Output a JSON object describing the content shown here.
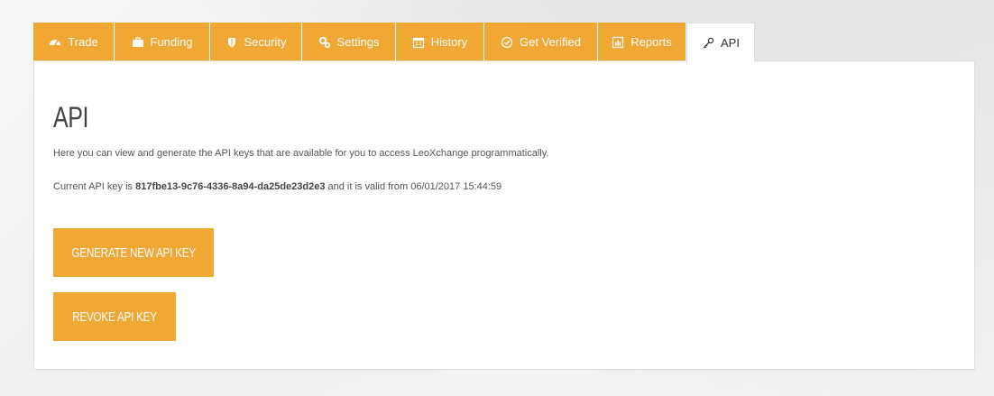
{
  "tabs": [
    {
      "label": "Trade",
      "icon": "dashboard-icon"
    },
    {
      "label": "Funding",
      "icon": "briefcase-icon"
    },
    {
      "label": "Security",
      "icon": "shield-icon"
    },
    {
      "label": "Settings",
      "icon": "cogs-icon"
    },
    {
      "label": "History",
      "icon": "calendar-icon"
    },
    {
      "label": "Get Verified",
      "icon": "check-circle-icon"
    },
    {
      "label": "Reports",
      "icon": "bar-chart-icon"
    },
    {
      "label": "API",
      "icon": "key-icon",
      "active": true
    }
  ],
  "panel": {
    "title": "API",
    "description": "Here you can view and generate the API keys that are available for you to access LeoXchange programmatically.",
    "key_prefix": "Current API key is ",
    "api_key": "817fbe13-9c76-4336-8a94-da25de23d2e3",
    "key_suffix": " and it is valid from 06/01/2017 15:44:59",
    "generate_label": "GENERATE NEW API KEY",
    "revoke_label": "REVOKE API KEY"
  },
  "colors": {
    "accent": "#f0a733",
    "background": "#ededed",
    "panel": "#ffffff"
  }
}
